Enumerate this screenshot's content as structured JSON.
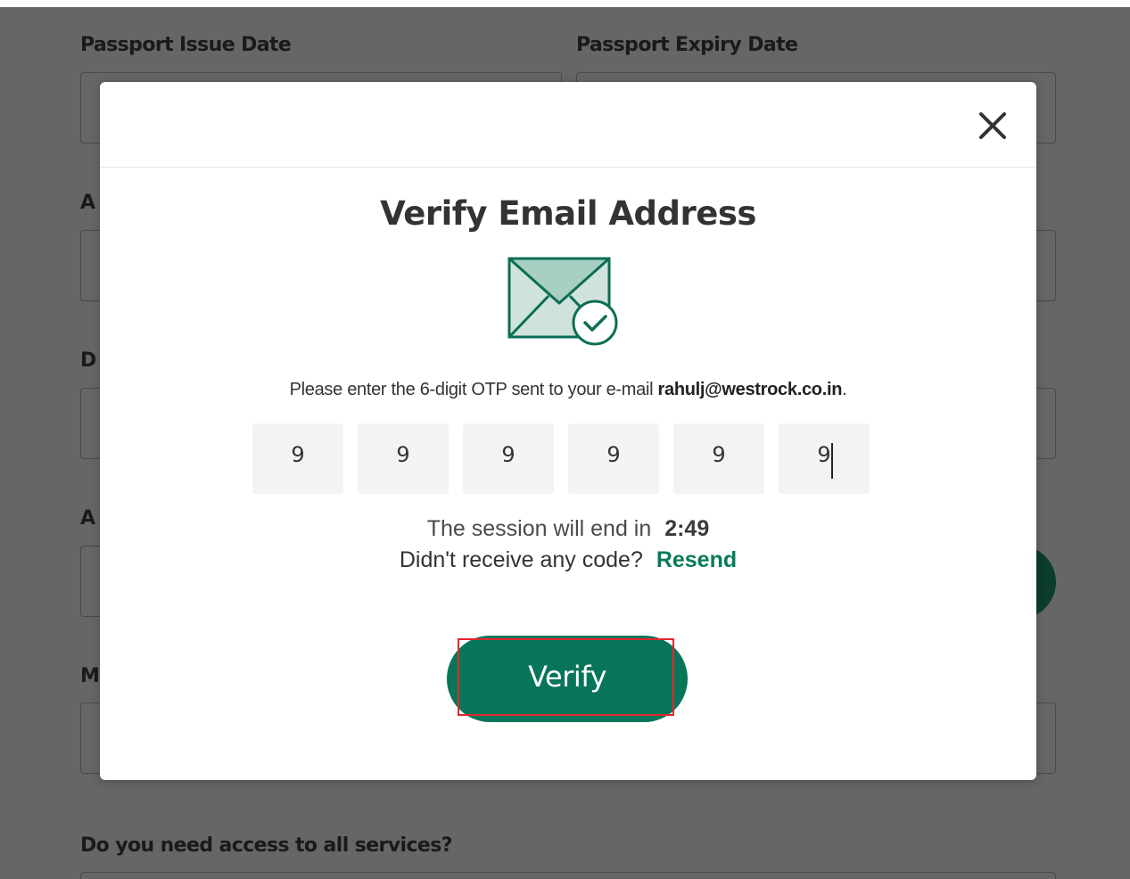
{
  "background_form": {
    "passport_issue_label": "Passport Issue Date",
    "passport_expiry_label": "Passport Expiry Date",
    "partial_label_1": "A",
    "partial_label_2": "D",
    "partial_label_3": "A",
    "partial_label_4": "M",
    "services_label": "Do you need access to all services?"
  },
  "modal": {
    "close_icon": "close-icon",
    "title": "Verify Email Address",
    "illustration_icon": "envelope-check-icon",
    "instruction_prefix": "Please enter the 6-digit OTP sent to your e-mail",
    "email": "rahulj@westrock.co.in",
    "instruction_suffix": ".",
    "otp": {
      "digits": [
        "9",
        "9",
        "9",
        "9",
        "9",
        "9"
      ]
    },
    "session_text": "The session will end in",
    "session_timer": "2:49",
    "no_code_text": "Didn't receive any code?",
    "resend_label": "Resend",
    "verify_label": "Verify"
  },
  "colors": {
    "overlay": "#666666",
    "brand_green": "#07755a",
    "link_green": "#087a5a",
    "highlight_red": "#e3262b"
  }
}
